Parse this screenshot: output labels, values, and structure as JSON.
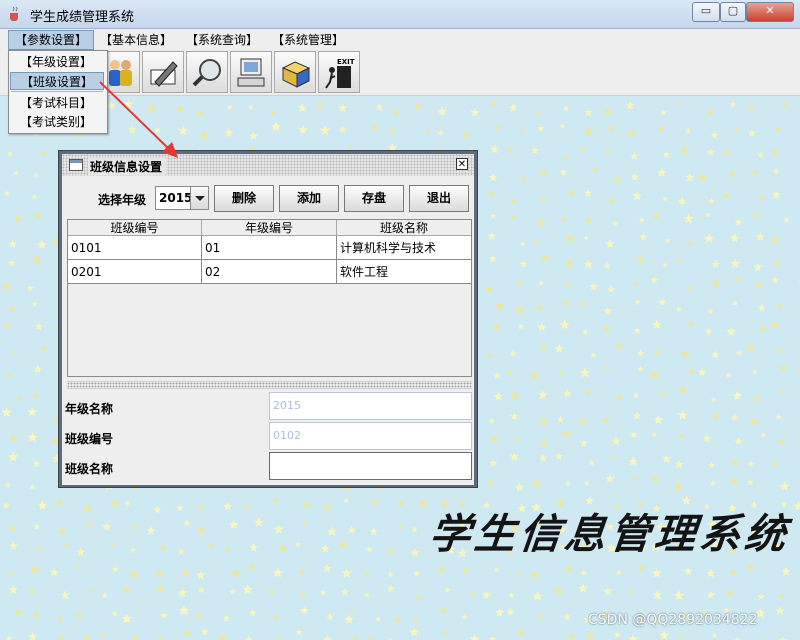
{
  "window": {
    "title": "学生成绩管理系统",
    "controls": {
      "minimize": "▭",
      "maximize": "▢",
      "close": "✕"
    }
  },
  "menubar": {
    "items": [
      "【参数设置】",
      "【基本信息】",
      "【系统查询】",
      "【系统管理】"
    ],
    "active_index": 0
  },
  "popup_menu": {
    "items": [
      "【年级设置】",
      "【班级设置】",
      "【考试科目】",
      "【考试类别】"
    ],
    "highlighted_index": 1
  },
  "toolbar": {
    "buttons": [
      "users-icon",
      "edit-icon",
      "search-icon",
      "computer-icon",
      "package-icon",
      "exit-icon"
    ],
    "exit_label": "EXIT"
  },
  "dialog": {
    "title": "班级信息设置",
    "close": "✕",
    "grade_label": "选择年级",
    "grade_value": "2015",
    "buttons": {
      "delete": "删除",
      "add": "添加",
      "save": "存盘",
      "exit": "退出"
    },
    "table": {
      "columns": [
        "班级编号",
        "年级编号",
        "班级名称"
      ],
      "rows": [
        [
          "0101",
          "01",
          "计算机科学与技术"
        ],
        [
          "0201",
          "02",
          "软件工程"
        ]
      ]
    },
    "form": {
      "grade_name_label": "年级名称",
      "grade_name_value": "2015",
      "class_id_label": "班级编号",
      "class_id_value": "0102",
      "class_name_label": "班级名称",
      "class_name_value": ""
    }
  },
  "decoration": {
    "calligraphy_text": "学生信息管理系统",
    "watermark": "CSDN @QQ2892034822",
    "arrow_color": "#e53935",
    "background_color": "#cfe9f2"
  }
}
